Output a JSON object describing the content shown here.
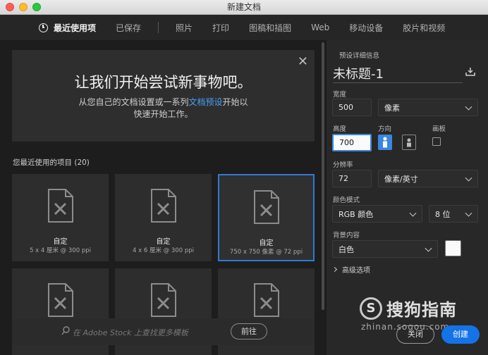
{
  "window": {
    "title": "新建文档"
  },
  "tabs": [
    {
      "label": "最近使用项",
      "active": true
    },
    {
      "label": "已保存"
    },
    {
      "label": "照片"
    },
    {
      "label": "打印"
    },
    {
      "label": "图稿和插图"
    },
    {
      "label": "Web"
    },
    {
      "label": "移动设备"
    },
    {
      "label": "胶片和视频"
    }
  ],
  "hero": {
    "title": "让我们开始尝试新事物吧。",
    "text_before": "从您自己的文档设置或一系列",
    "link": "文档预设",
    "text_after": "开始以",
    "line2": "快速开始工作。"
  },
  "recent": {
    "label": "您最近使用的项目",
    "count": "(20)",
    "items": [
      {
        "name": "自定",
        "desc": "5 x 4 厘米 @ 300 ppi"
      },
      {
        "name": "自定",
        "desc": "4 x 6 厘米 @ 300 ppi"
      },
      {
        "name": "自定",
        "desc": "750 x 750 像素 @ 72 ppi",
        "selected": true
      },
      {
        "name": "",
        "desc": ""
      },
      {
        "name": "",
        "desc": ""
      },
      {
        "name": "",
        "desc": ""
      }
    ]
  },
  "stock": {
    "placeholder": "在 Adobe Stock 上查找更多模板",
    "go_label": "前往"
  },
  "details": {
    "header": "预设详细信息",
    "doc_title": "未标题-1",
    "width_label": "宽度",
    "width_value": "500",
    "width_unit": "像素",
    "height_label": "高度",
    "height_value": "700",
    "orientation_label": "方向",
    "artboard_label": "画板",
    "resolution_label": "分辨率",
    "resolution_value": "72",
    "resolution_unit": "像素/英寸",
    "color_mode_label": "颜色模式",
    "color_mode_value": "RGB 颜色",
    "bit_depth": "8 位",
    "bg_label": "背景内容",
    "bg_value": "白色",
    "advanced_label": "高级选项"
  },
  "footer": {
    "close_label": "关闭",
    "create_label": "创建"
  },
  "watermark": {
    "brand": "搜狗指南",
    "url": "zhinan.sogou.com"
  },
  "colors": {
    "accent": "#1473e6",
    "selection": "#2f7ad6",
    "link": "#4d9ff5"
  }
}
